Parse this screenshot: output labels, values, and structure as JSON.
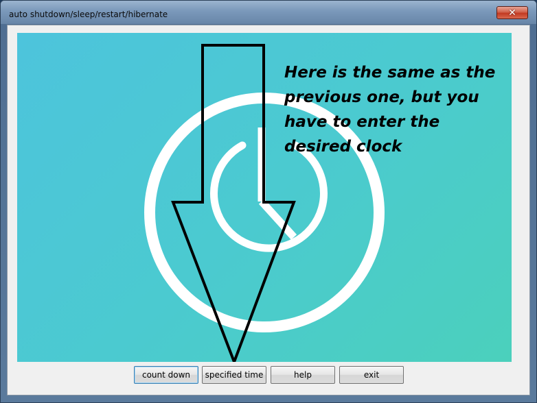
{
  "window": {
    "title": "auto shutdown/sleep/restart/hibernate",
    "close_glyph": "✕"
  },
  "image": {
    "caption": "Here is the same as the previous one, but you have to enter the desired clock",
    "icon": "clock-power-icon",
    "background_colors": [
      "#4dc4dc",
      "#4bd0bc"
    ]
  },
  "buttons": {
    "count_down": "count down",
    "specified_time": "specified time",
    "help": "help",
    "exit": "exit"
  }
}
